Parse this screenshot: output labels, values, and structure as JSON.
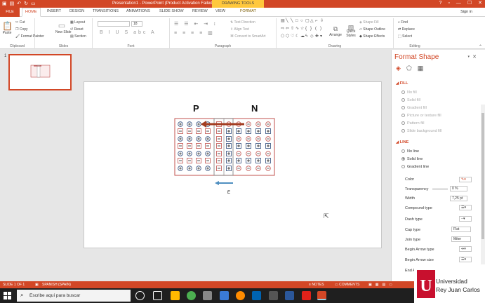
{
  "titlebar": {
    "title": "Presentation1 - PowerPoint (Product Activation Failed)",
    "context_label": "DRAWING TOOLS",
    "help": "?"
  },
  "tabs": [
    "FILE",
    "HOME",
    "INSERT",
    "DESIGN",
    "TRANSITIONS",
    "ANIMATIONS",
    "SLIDE SHOW",
    "REVIEW",
    "VIEW",
    "FORMAT"
  ],
  "sign_in": "Sign in",
  "ribbon": {
    "clipboard": {
      "paste": "Paste",
      "cut": "Cut",
      "copy": "Copy",
      "format_painter": "Format Painter",
      "label": "Clipboard"
    },
    "slides": {
      "new_slide": "New Slide",
      "layout": "Layout",
      "reset": "Reset",
      "section": "Section",
      "label": "Slides"
    },
    "font": {
      "size": "18",
      "label": "Font"
    },
    "paragraph": {
      "text_direction": "Text Direction",
      "align_text": "Align Text",
      "convert": "Convert to SmartArt",
      "label": "Paragraph"
    },
    "drawing": {
      "arrange": "Arrange",
      "quick_styles": "Quick Styles",
      "shape_fill": "Shape Fill",
      "shape_outline": "Shape Outline",
      "shape_effects": "Shape Effects",
      "label": "Drawing"
    },
    "editing": {
      "find": "Find",
      "replace": "Replace",
      "select": "Select",
      "label": "Editing"
    }
  },
  "thumbnail": {
    "number": "1"
  },
  "slide": {
    "label_p": "P",
    "label_n": "N",
    "label_e": "E"
  },
  "format_pane": {
    "title": "Format Shape",
    "fill_header": "FILL",
    "fill_options": [
      "No fill",
      "Solid fill",
      "Gradient fill",
      "Picture or texture fill",
      "Pattern fill",
      "Slide background fill"
    ],
    "line_header": "LINE",
    "line_options": [
      "No line",
      "Solid line",
      "Gradient line"
    ],
    "props": {
      "color": "Color",
      "transparency": "Transparency",
      "transparency_value": "0 %",
      "width": "Width",
      "width_value": "7,25 pt",
      "compound": "Compound type",
      "dash": "Dash type",
      "cap": "Cap type",
      "cap_value": "Flat",
      "join": "Join type",
      "join_value": "Miter",
      "begin_type": "Begin Arrow type",
      "begin_size": "Begin Arrow size",
      "end_type": "End Arrow type"
    }
  },
  "statusbar": {
    "slide": "SLIDE 1 OF 1",
    "language": "SPANISH (SPAIN)",
    "notes": "NOTES",
    "comments": "COMMENTS"
  },
  "taskbar": {
    "search": "Escribe aquí para buscar"
  },
  "logo": {
    "line1": "Universidad",
    "line2": "Rey Juan Carlos"
  },
  "colors": {
    "accent": "#d24726",
    "context": "#ffc83d",
    "electron_arrow": "#4f8fc0",
    "p_type_border": "#c0504d",
    "ion_border": "#2e4a7a"
  }
}
